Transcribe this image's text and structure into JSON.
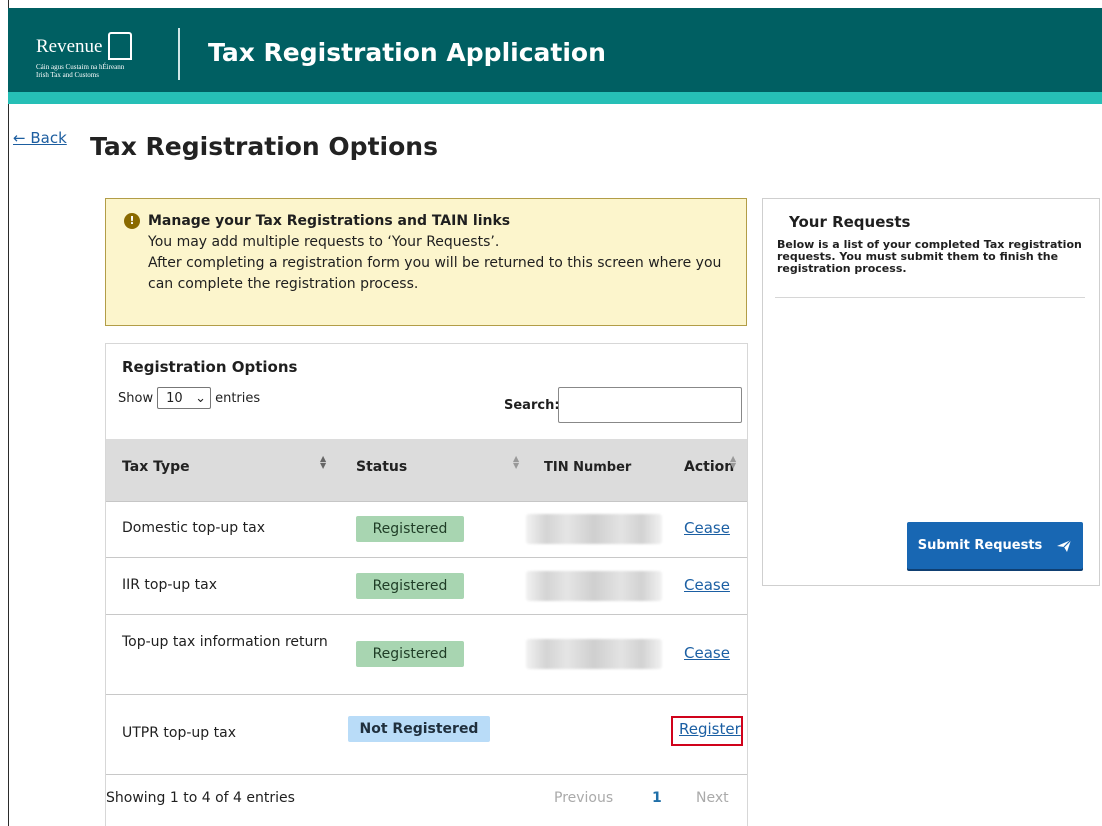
{
  "brand": {
    "logo_text": "Revenue",
    "logo_subtext_line1": "Cáin agus Custaim na hÉireann",
    "logo_subtext_line2": "Irish Tax and Customs"
  },
  "header": {
    "app_title": "Tax Registration Application"
  },
  "nav": {
    "back_label": "← Back"
  },
  "page": {
    "title": "Tax Registration Options"
  },
  "notice": {
    "title": "Manage your Tax Registrations and TAIN links",
    "line1": "You may add multiple requests to ‘Your Requests’.",
    "line2": "After completing a registration form you will be returned to this screen where you can complete the registration process."
  },
  "registration": {
    "title": "Registration Options",
    "show_label": "Show",
    "entries_value": "10",
    "entries_label": "entries",
    "search_label": "Search:",
    "search_value": "",
    "columns": [
      "Tax Type",
      "Status",
      "TIN Number",
      "Action"
    ],
    "rows": [
      {
        "tax_type": "Domestic top-up tax",
        "status": "Registered",
        "action": "Cease"
      },
      {
        "tax_type": "IIR top-up tax",
        "status": "Registered",
        "action": "Cease"
      },
      {
        "tax_type": "Top-up tax information return",
        "status": "Registered",
        "action": "Cease"
      },
      {
        "tax_type": "UTPR top-up tax",
        "status": "Not Registered",
        "action": "Register"
      }
    ],
    "showing": "Showing 1 to 4 of 4 entries",
    "pager": {
      "previous": "Previous",
      "page": "1",
      "next": "Next"
    }
  },
  "requests": {
    "title": "Your Requests",
    "description": "Below is a list of your completed Tax registration requests. You must submit them to finish the registration process.",
    "submit_label": "Submit Requests"
  },
  "colors": {
    "header_bg": "#005f62",
    "stripe": "#26bfb6",
    "link": "#1b5fa3",
    "registered_badge": "#a8d5b1",
    "not_registered_badge": "#b9dcf8",
    "submit_button": "#1867b3",
    "highlight": "#d0021b"
  },
  "icons": {
    "warning": "exclamation-circle-icon",
    "submit": "paper-plane-icon",
    "select": "chevron-down-icon",
    "sort": "sort-arrows-icon"
  }
}
